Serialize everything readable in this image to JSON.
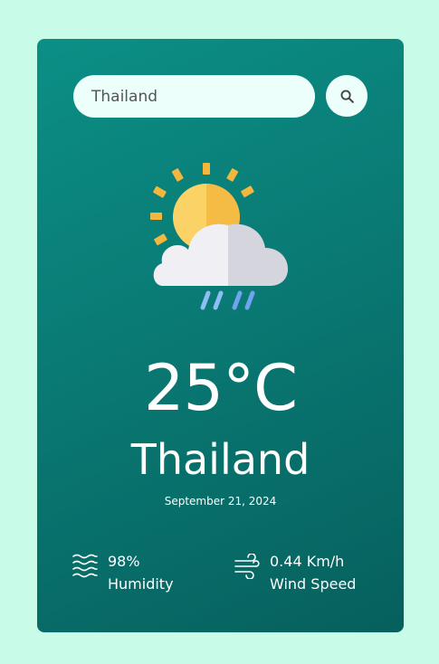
{
  "search": {
    "value": "Thailand",
    "button_icon": "search-icon"
  },
  "weather": {
    "icon": "sun-cloud-rain-icon",
    "temperature": "25°C",
    "city": "Thailand",
    "date": "September 21, 2024"
  },
  "humidity": {
    "icon": "humidity-waves-icon",
    "value": "98%",
    "label": "Humidity"
  },
  "wind": {
    "icon": "wind-icon",
    "value": "0.44 Km/h",
    "label": "Wind Speed"
  },
  "colors": {
    "page_background": "#c8fce8",
    "card_gradient_start": "#0b8f86",
    "card_gradient_end": "#06605d",
    "search_background": "#ecfffb",
    "text": "#ffffff"
  }
}
